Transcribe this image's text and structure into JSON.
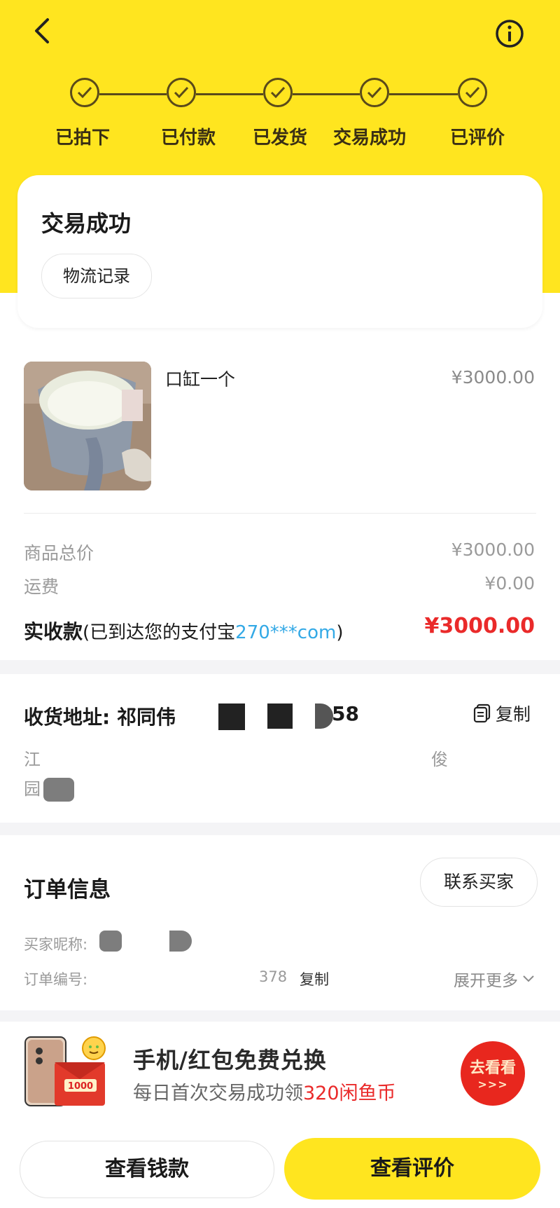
{
  "header": {
    "steps": [
      "已拍下",
      "已付款",
      "已发货",
      "交易成功",
      "已评价"
    ]
  },
  "status": {
    "title": "交易成功",
    "logistics_label": "物流记录"
  },
  "product": {
    "name": "口缸一个",
    "price": "¥3000.00"
  },
  "summary": {
    "total_label": "商品总价",
    "total_value": "¥3000.00",
    "shipping_label": "运费",
    "shipping_value": "¥0.00",
    "net_label": "实收款",
    "net_note_prefix": "(已到达您的支付宝",
    "net_account": "270***com",
    "net_note_suffix": ")",
    "net_value": "¥3000.00"
  },
  "address": {
    "title": "收货地址: 祁同伟",
    "phone_tail": "58",
    "copy_label": "复制",
    "line1_start": "江",
    "line1_end": "俊",
    "line2_start": "园"
  },
  "order": {
    "title": "订单信息",
    "contact_label": "联系买家",
    "buyer_label": "买家昵称:",
    "order_no_label": "订单编号:",
    "order_no_tail": "378",
    "copy_label": "复制",
    "expand_label": "展开更多"
  },
  "promo": {
    "title": "手机/红包免费兑换",
    "subtitle_prefix": "每日首次交易成功领",
    "subtitle_highlight": "320闲鱼币",
    "goto_label": "去看看",
    "goto_arrows": ">>>",
    "badge_amount": "1000"
  },
  "footer": {
    "money_label": "查看钱款",
    "review_label": "查看评价"
  },
  "colors": {
    "brand_yellow": "#ffe51f",
    "price_red": "#ea2a2a",
    "link_blue": "#33a9e6"
  }
}
